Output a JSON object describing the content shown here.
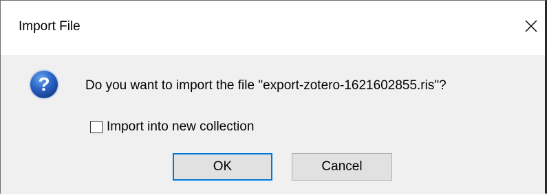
{
  "dialog": {
    "title": "Import File",
    "close_icon": "close-icon",
    "question_icon": "question-icon",
    "message": "Do you want to import the file \"export-zotero-1621602855.ris\"?",
    "checkbox": {
      "label": "Import into new collection",
      "checked": false
    },
    "buttons": {
      "ok": "OK",
      "cancel": "Cancel"
    },
    "colors": {
      "focus_border": "#0078d7",
      "body_background": "#f0f0f0",
      "title_background": "#ffffff"
    }
  }
}
